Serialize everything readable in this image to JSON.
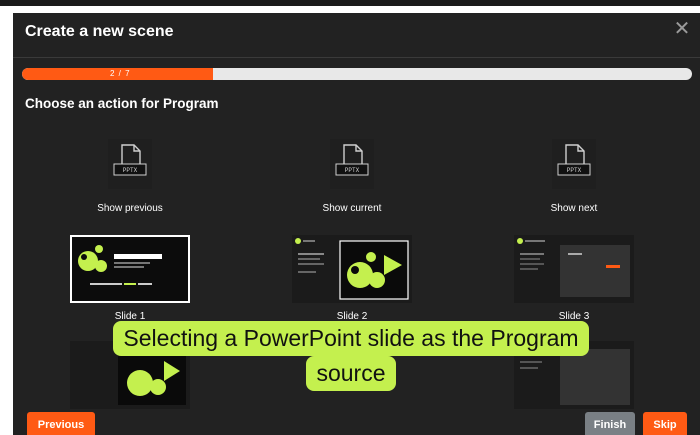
{
  "dialog": {
    "title": "Create a new scene",
    "close_icon": "close-icon"
  },
  "progress": {
    "text": "2 / 7",
    "current": 2,
    "total": 7,
    "color": "#ff5a14"
  },
  "subtitle": "Choose an action for Program",
  "actions": [
    {
      "label": "Show previous",
      "icon_text": "PPTX",
      "icon": "pptx-file-icon"
    },
    {
      "label": "Show current",
      "icon_text": "PPTX",
      "icon": "pptx-file-icon"
    },
    {
      "label": "Show next",
      "icon_text": "PPTX",
      "icon": "pptx-file-icon"
    }
  ],
  "slides": [
    {
      "label": "Slide 1",
      "selected": true,
      "thumb_title": "Getyour Studio"
    },
    {
      "label": "Slide 2",
      "selected": false
    },
    {
      "label": "Slide 3",
      "selected": false
    }
  ],
  "buttons": {
    "previous": "Previous",
    "finish": "Finish",
    "skip": "Skip"
  },
  "caption": {
    "line1": "Selecting a PowerPoint slide as the Program",
    "line2": "source",
    "color": "#c4f04e"
  },
  "colors": {
    "accent": "#ff5a14",
    "brand_green": "#c4f04e",
    "background": "#222222"
  }
}
